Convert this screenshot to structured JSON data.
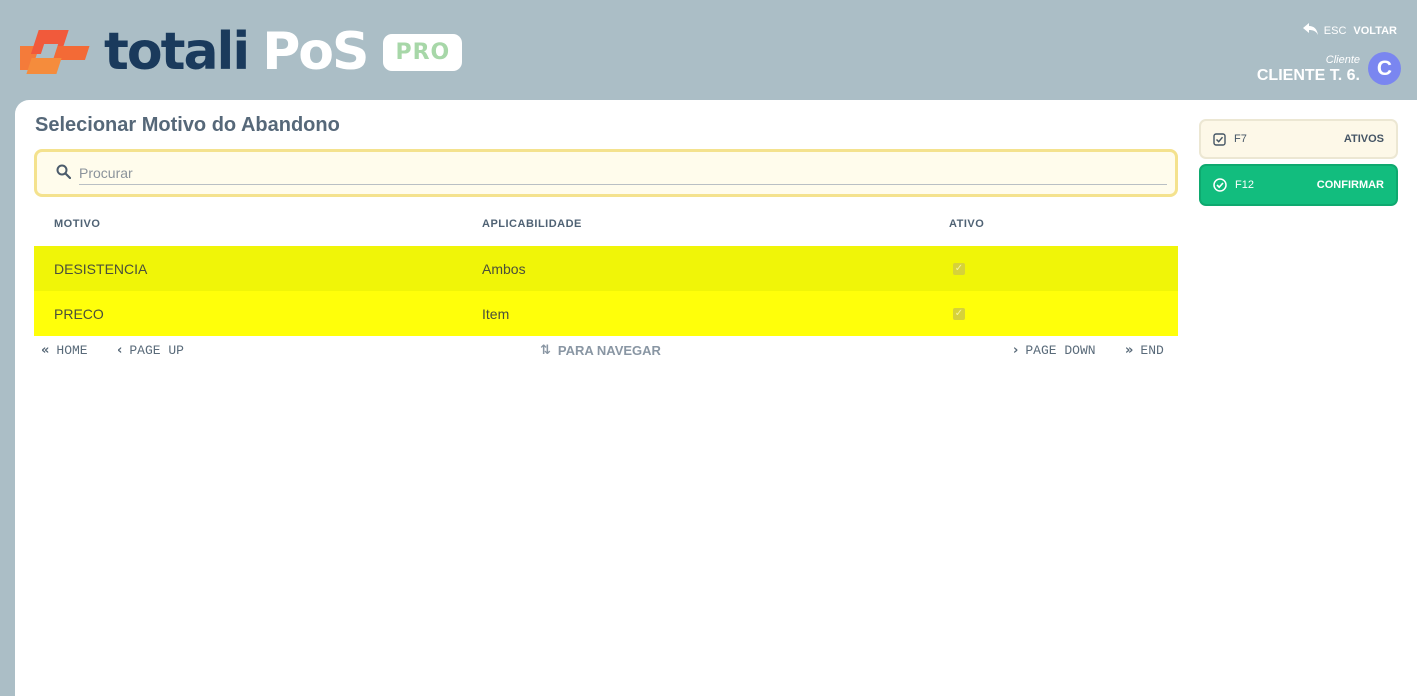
{
  "header": {
    "logo_word": "totali",
    "logo_pos": "PoS",
    "logo_badge": "PRO",
    "esc_key": "ESC",
    "esc_label": "VOLTAR",
    "client_label": "Cliente",
    "client_name": "CLIENTE T. 6.",
    "avatar_letter": "C"
  },
  "main": {
    "title": "Selecionar Motivo do Abandono",
    "search": {
      "placeholder": "Procurar",
      "value": ""
    },
    "columns": [
      "MOTIVO",
      "APLICABILIDADE",
      "ATIVO"
    ],
    "rows": [
      {
        "motivo": "DESISTENCIA",
        "aplicabilidade": "Ambos",
        "ativo": true,
        "color": "#f0f508"
      },
      {
        "motivo": "PRECO",
        "aplicabilidade": "Item",
        "ativo": true,
        "color": "#ffff0a"
      }
    ],
    "nav": {
      "home": "HOME",
      "page_up": "PAGE UP",
      "center": "PARA NAVEGAR",
      "page_down": "PAGE DOWN",
      "end": "END"
    }
  },
  "actions": [
    {
      "key": "F7",
      "label": "ATIVOS",
      "icon": "checkbox-icon"
    },
    {
      "key": "F12",
      "label": "CONFIRMAR",
      "icon": "check-circle-icon"
    }
  ],
  "colors": {
    "background": "#abbec6",
    "confirm": "#12bd7e",
    "row_highlight": "#f0f508",
    "avatar": "#7a86f0"
  }
}
